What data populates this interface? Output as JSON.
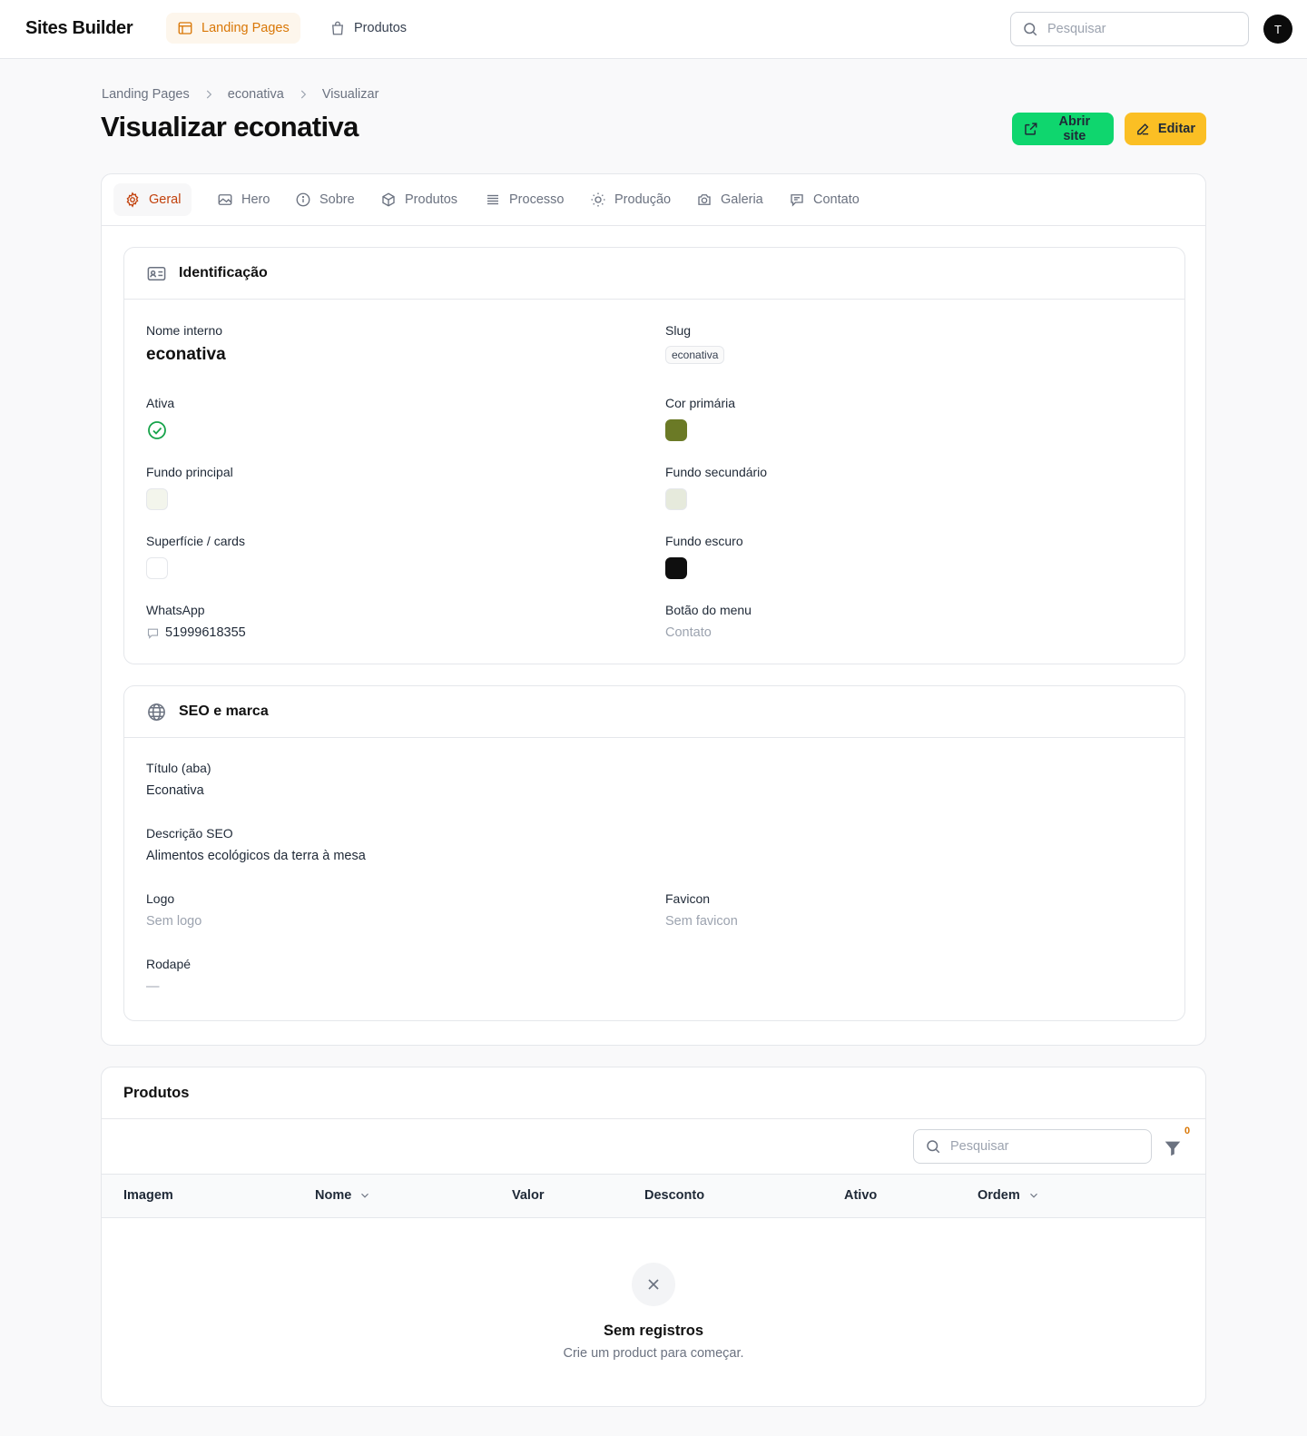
{
  "app": {
    "brand": "Sites Builder",
    "avatar_initial": "T"
  },
  "nav": {
    "landing_pages": "Landing Pages",
    "produtos": "Produtos"
  },
  "top_search": {
    "placeholder": "Pesquisar"
  },
  "breadcrumb": [
    "Landing Pages",
    "econativa",
    "Visualizar"
  ],
  "page": {
    "title": "Visualizar econativa"
  },
  "actions": {
    "open_site": "Abrir site",
    "edit": "Editar"
  },
  "tabs": [
    "Geral",
    "Hero",
    "Sobre",
    "Produtos",
    "Processo",
    "Produção",
    "Galeria",
    "Contato"
  ],
  "identificacao": {
    "title": "Identificação",
    "nome_interno": {
      "label": "Nome interno",
      "value": "econativa"
    },
    "slug": {
      "label": "Slug",
      "value": "econativa"
    },
    "ativa": {
      "label": "Ativa",
      "value": true
    },
    "cor_primaria": {
      "label": "Cor primária",
      "color": "#6b7a26"
    },
    "fundo_principal": {
      "label": "Fundo principal",
      "color": "#f3f5ec"
    },
    "fundo_secundario": {
      "label": "Fundo secundário",
      "color": "#e6eadc"
    },
    "superficie": {
      "label": "Superfície / cards",
      "color": "#ffffff"
    },
    "fundo_escuro": {
      "label": "Fundo escuro",
      "color": "#0f0f0f"
    },
    "whatsapp": {
      "label": "WhatsApp",
      "value": "51999618355"
    },
    "botao_menu": {
      "label": "Botão do menu",
      "value": "Contato"
    }
  },
  "seo": {
    "title": "SEO e marca",
    "titulo_aba": {
      "label": "Título (aba)",
      "value": "Econativa"
    },
    "descricao": {
      "label": "Descrição SEO",
      "value": "Alimentos ecológicos da terra à mesa"
    },
    "logo": {
      "label": "Logo",
      "value": "Sem logo"
    },
    "favicon": {
      "label": "Favicon",
      "value": "Sem favicon"
    },
    "rodape": {
      "label": "Rodapé",
      "value": "—"
    }
  },
  "produtos_table": {
    "title": "Produtos",
    "search_placeholder": "Pesquisar",
    "filter_count": "0",
    "columns": [
      "Imagem",
      "Nome",
      "Valor",
      "Desconto",
      "Ativo",
      "Ordem"
    ],
    "empty_title": "Sem registros",
    "empty_subtitle": "Crie um product para começar."
  },
  "colors": {
    "accent": "#d97706",
    "success": "#16a34a",
    "green_button": "#0fd66e",
    "amber_button": "#fbbf24"
  }
}
